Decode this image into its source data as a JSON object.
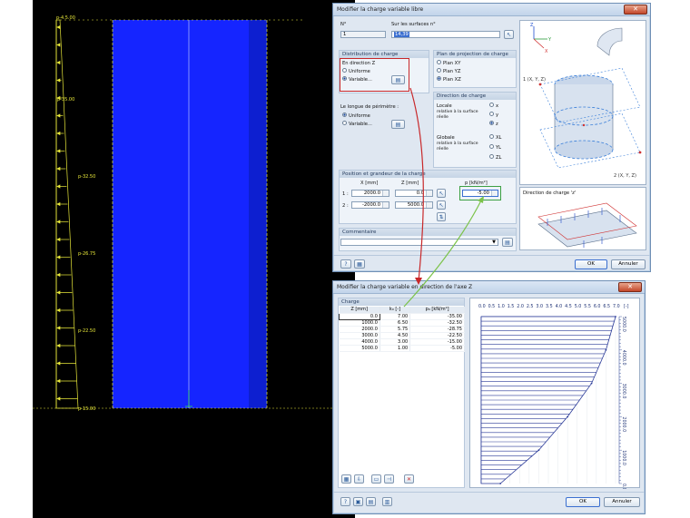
{
  "viewport": {
    "load_labels": [
      "p-4.5.00",
      "p-35.00",
      "p-32.50",
      "p-26.75",
      "p-22.50",
      "p-15.00"
    ],
    "colors": {
      "panel": "#1525ff",
      "load": "#e9e93a",
      "background": "#000000"
    }
  },
  "dialog1": {
    "title": "Modifier la charge variable libre",
    "no_label": "N°",
    "no_value": "1",
    "surfaces_label": "Sur les surfaces n°",
    "surfaces_value": "14,39",
    "dist_header": "Distribution de charge",
    "dist_direction": "En direction Z",
    "dist_uniform": "Uniforme",
    "dist_variable": "Variable...",
    "plan_header": "Plan de projection de charge",
    "plan_xy": "Plan XY",
    "plan_yz": "Plan YZ",
    "plan_xz": "Plan XZ",
    "dir_header": "Direction de charge",
    "locale": "Locale",
    "locale_sub1": "relative à la surface",
    "locale_sub2": "réelle",
    "dir_x": "x",
    "dir_y": "y",
    "dir_z": "z",
    "globale": "Globale",
    "globale_sub1": "relative à la surface",
    "globale_sub2": "réelle",
    "dir_xl": "XL",
    "dir_yl": "YL",
    "dir_zl": "ZL",
    "perim_header": "Le longue de périmètre :",
    "perim_uniform": "Uniforme",
    "perim_variable": "Variable...",
    "pos_header": "Position et grandeur de la charge",
    "col_x": "X [mm]",
    "col_z": "Z [mm]",
    "col_p": "p  [kN/m²]",
    "rows": [
      {
        "n": "1 :",
        "x": "2000.0",
        "z": "0.0",
        "p": "-5.00"
      },
      {
        "n": "2 :",
        "x": "-2000.0",
        "z": "5000.0",
        "p": ""
      }
    ],
    "comment_header": "Commentaire",
    "preview_axis_y": "Y",
    "preview_axis_x": "X",
    "preview_axis_z": "Z",
    "pt1": "1 (X, Y, Z)",
    "pt2": "2 (X, Y, Z)",
    "dir_caption": "Direction de charge 'z'",
    "ok": "OK",
    "cancel": "Annuler"
  },
  "dialog2": {
    "title": "Modifier la charge variable en direction de l'axe Z",
    "grp_header": "Charge",
    "col_z": "Z [mm]",
    "col_k": "k₀ [-]",
    "col_p": "p₀ [kN/m²]",
    "rows": [
      {
        "z": "0.0",
        "k": "7.00",
        "p": "-35.00"
      },
      {
        "z": "1000.0",
        "k": "6.50",
        "p": "-32.50"
      },
      {
        "z": "2000.0",
        "k": "5.75",
        "p": "-28.75"
      },
      {
        "z": "3000.0",
        "k": "4.50",
        "p": "-22.50"
      },
      {
        "z": "4000.0",
        "k": "3.00",
        "p": "-15.00"
      },
      {
        "z": "5000.0",
        "k": "1.00",
        "p": "-5.00"
      }
    ],
    "diagram_top_ticks": [
      "0.0",
      "0.5",
      "1.0",
      "1.5",
      "2.0",
      "2.5",
      "3.0",
      "3.5",
      "4.0",
      "4.5",
      "5.0",
      "5.5",
      "6.0",
      "6.5",
      "7.0",
      "[-]"
    ],
    "diagram_z_label": "Z [mm]",
    "diagram_right_ticks": [
      "5000.0",
      "4000.0",
      "3000.0",
      "2000.0",
      "1000.0",
      "0.0"
    ],
    "ok": "OK",
    "cancel": "Annuler"
  },
  "chart_data": {
    "type": "area",
    "x": [
      0,
      1000,
      2000,
      3000,
      4000,
      5000
    ],
    "values": [
      7.0,
      6.5,
      5.75,
      4.5,
      3.0,
      1.0
    ],
    "xlabel": "Z [mm]",
    "ylabel": "[-]",
    "ylim": [
      0,
      7
    ],
    "xlim": [
      0,
      5000
    ]
  }
}
